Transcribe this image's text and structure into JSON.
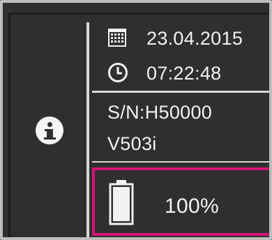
{
  "device": {
    "date": "23.04.2015",
    "time": "07:22:48",
    "serial": "S/N:H50000",
    "version": "V503i",
    "battery_level": "100%",
    "battery_fraction": 1.0
  },
  "icons": {
    "info": "info-icon",
    "date": "calendar-icon",
    "time": "clock-icon",
    "battery": "battery-icon"
  },
  "colors": {
    "background": "#2f2f2f",
    "text": "#f2f2f2",
    "highlight": "#d6157a",
    "divider": "#d9d9d9"
  }
}
